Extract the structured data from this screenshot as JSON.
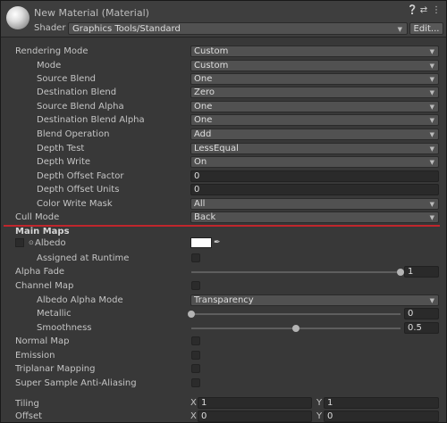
{
  "header": {
    "title": "New Material (Material)",
    "shader_label": "Shader",
    "shader_value": "Graphics Tools/Standard",
    "edit_label": "Edit..."
  },
  "rendering": {
    "rendering_mode": {
      "label": "Rendering Mode",
      "value": "Custom"
    },
    "mode": {
      "label": "Mode",
      "value": "Custom"
    },
    "source_blend": {
      "label": "Source Blend",
      "value": "One"
    },
    "destination_blend": {
      "label": "Destination Blend",
      "value": "Zero"
    },
    "source_blend_alpha": {
      "label": "Source Blend Alpha",
      "value": "One"
    },
    "destination_blend_alpha": {
      "label": "Destination Blend Alpha",
      "value": "One"
    },
    "blend_operation": {
      "label": "Blend Operation",
      "value": "Add"
    },
    "depth_test": {
      "label": "Depth Test",
      "value": "LessEqual"
    },
    "depth_write": {
      "label": "Depth Write",
      "value": "On"
    },
    "depth_offset_factor": {
      "label": "Depth Offset Factor",
      "value": "0"
    },
    "depth_offset_units": {
      "label": "Depth Offset Units",
      "value": "0"
    },
    "color_write_mask": {
      "label": "Color Write Mask",
      "value": "All"
    },
    "cull_mode": {
      "label": "Cull Mode",
      "value": "Back"
    }
  },
  "main_maps": {
    "title": "Main Maps",
    "albedo": {
      "label": "Albedo",
      "color": "#ffffff"
    },
    "assigned_at_runtime": {
      "label": "Assigned at Runtime"
    },
    "alpha_fade": {
      "label": "Alpha Fade",
      "value": "1",
      "fraction": 1.0
    },
    "channel_map": {
      "label": "Channel Map"
    },
    "albedo_alpha_mode": {
      "label": "Albedo Alpha Mode",
      "value": "Transparency"
    },
    "metallic": {
      "label": "Metallic",
      "value": "0",
      "fraction": 0.0
    },
    "smoothness": {
      "label": "Smoothness",
      "value": "0.5",
      "fraction": 0.5
    },
    "normal_map": {
      "label": "Normal Map"
    },
    "emission": {
      "label": "Emission"
    },
    "triplanar_mapping": {
      "label": "Triplanar Mapping"
    },
    "super_sample": {
      "label": "Super Sample Anti-Aliasing"
    },
    "tiling": {
      "label": "Tiling",
      "x_label": "X",
      "x": "1",
      "y_label": "Y",
      "y": "1"
    },
    "offset": {
      "label": "Offset",
      "x_label": "X",
      "x": "0",
      "y_label": "Y",
      "y": "0"
    }
  },
  "colors": {
    "accent_line": "#c0262c"
  }
}
